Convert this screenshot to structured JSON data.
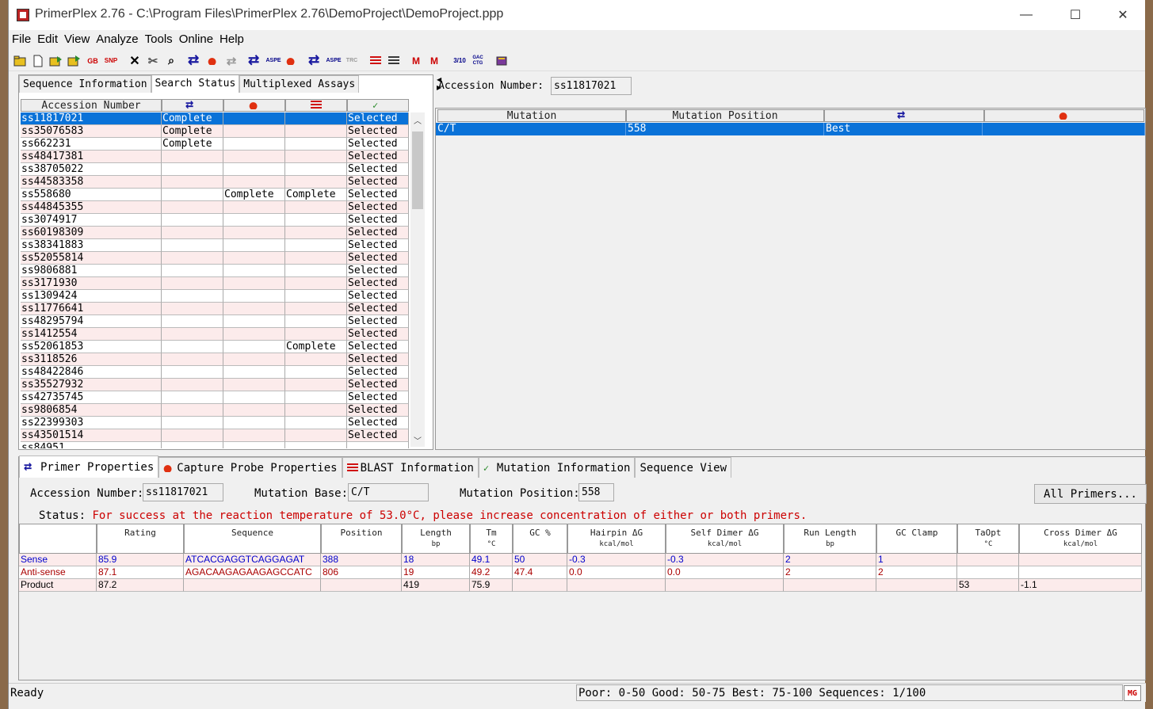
{
  "window": {
    "title": "PrimerPlex 2.76 - C:\\Program Files\\PrimerPlex 2.76\\DemoProject\\DemoProject.ppp",
    "minimize": "—",
    "maximize": "☐",
    "close": "✕"
  },
  "menu": [
    "File",
    "Edit",
    "View",
    "Analyze",
    "Tools",
    "Online",
    "Help"
  ],
  "toolbar": {
    "icons": [
      "open-folder-icon",
      "new-file-icon",
      "open-project-icon",
      "save-project-icon",
      "genbank-icon",
      "snp-icon",
      "delete-icon",
      "tools-icon",
      "find-icon",
      "primer-search-icon",
      "probe-search-icon",
      "primer-disabled-icon",
      "primer-icon",
      "aspe-icon",
      "probe-icon",
      "multiplex-icon",
      "aspe-multiplex-icon",
      "trc-icon",
      "blast-icon",
      "blast-table-icon",
      "mutation-icon",
      "mutation-remove-icon",
      "ratio-icon",
      "sequence-icon",
      "book-icon"
    ],
    "genbank_label": "GB",
    "snp_label": "SNP",
    "aspe_label": "ASPE",
    "aspe2_label": "ASPE",
    "trc_label": "TRC",
    "ratio_label": "3/10",
    "seq_label": "GAC CTG"
  },
  "left_tabs": [
    "Sequence Information",
    "Search Status",
    "Multiplexed Assays"
  ],
  "left_active_tab": "Search Status",
  "search_table": {
    "headers": [
      "Accession Number",
      "primer-icon",
      "probe-icon",
      "blast-icon",
      "mutation-icon"
    ],
    "rows": [
      {
        "acc": "ss11817021",
        "primer": "Complete",
        "probe": "",
        "blast": "",
        "mutation": "Selected"
      },
      {
        "acc": "ss35076583",
        "primer": "Complete",
        "probe": "",
        "blast": "",
        "mutation": "Selected"
      },
      {
        "acc": "ss662231",
        "primer": "Complete",
        "probe": "",
        "blast": "",
        "mutation": "Selected"
      },
      {
        "acc": "ss48417381",
        "primer": "",
        "probe": "",
        "blast": "",
        "mutation": "Selected"
      },
      {
        "acc": "ss38705022",
        "primer": "",
        "probe": "",
        "blast": "",
        "mutation": "Selected"
      },
      {
        "acc": "ss44583358",
        "primer": "",
        "probe": "",
        "blast": "",
        "mutation": "Selected"
      },
      {
        "acc": "ss558680",
        "primer": "",
        "probe": "Complete",
        "blast": "Complete",
        "mutation": "Selected"
      },
      {
        "acc": "ss44845355",
        "primer": "",
        "probe": "",
        "blast": "",
        "mutation": "Selected"
      },
      {
        "acc": "ss3074917",
        "primer": "",
        "probe": "",
        "blast": "",
        "mutation": "Selected"
      },
      {
        "acc": "ss60198309",
        "primer": "",
        "probe": "",
        "blast": "",
        "mutation": "Selected"
      },
      {
        "acc": "ss38341883",
        "primer": "",
        "probe": "",
        "blast": "",
        "mutation": "Selected"
      },
      {
        "acc": "ss52055814",
        "primer": "",
        "probe": "",
        "blast": "",
        "mutation": "Selected"
      },
      {
        "acc": "ss9806881",
        "primer": "",
        "probe": "",
        "blast": "",
        "mutation": "Selected"
      },
      {
        "acc": "ss3171930",
        "primer": "",
        "probe": "",
        "blast": "",
        "mutation": "Selected"
      },
      {
        "acc": "ss1309424",
        "primer": "",
        "probe": "",
        "blast": "",
        "mutation": "Selected"
      },
      {
        "acc": "ss11776641",
        "primer": "",
        "probe": "",
        "blast": "",
        "mutation": "Selected"
      },
      {
        "acc": "ss48295794",
        "primer": "",
        "probe": "",
        "blast": "",
        "mutation": "Selected"
      },
      {
        "acc": "ss1412554",
        "primer": "",
        "probe": "",
        "blast": "",
        "mutation": "Selected"
      },
      {
        "acc": "ss52061853",
        "primer": "",
        "probe": "",
        "blast": "Complete",
        "mutation": "Selected"
      },
      {
        "acc": "ss3118526",
        "primer": "",
        "probe": "",
        "blast": "",
        "mutation": "Selected"
      },
      {
        "acc": "ss48422846",
        "primer": "",
        "probe": "",
        "blast": "",
        "mutation": "Selected"
      },
      {
        "acc": "ss35527932",
        "primer": "",
        "probe": "",
        "blast": "",
        "mutation": "Selected"
      },
      {
        "acc": "ss42735745",
        "primer": "",
        "probe": "",
        "blast": "",
        "mutation": "Selected"
      },
      {
        "acc": "ss9806854",
        "primer": "",
        "probe": "",
        "blast": "",
        "mutation": "Selected"
      },
      {
        "acc": "ss22399303",
        "primer": "",
        "probe": "",
        "blast": "",
        "mutation": "Selected"
      },
      {
        "acc": "ss43501514",
        "primer": "",
        "probe": "",
        "blast": "",
        "mutation": "Selected"
      },
      {
        "acc": "ss84951",
        "primer": "",
        "probe": "",
        "blast": "",
        "mutation": ""
      }
    ],
    "selected_index": 0
  },
  "right_panel": {
    "accession_label": "Accession Number:",
    "accession_value": "ss11817021",
    "mutation_headers": [
      "Mutation",
      "Mutation Position",
      "primer-icon",
      "probe-icon"
    ],
    "mutation_row": [
      "C/T",
      "558",
      "Best",
      ""
    ]
  },
  "bottom_tabs": [
    "Primer Properties",
    "Capture Probe Properties",
    "BLAST Information",
    "Mutation Information",
    "Sequence View"
  ],
  "bottom_active_tab": "Primer Properties",
  "primer_props": {
    "accession_label": "Accession Number:",
    "accession_value": "ss11817021",
    "mutation_base_label": "Mutation Base:",
    "mutation_base_value": "C/T",
    "mutation_position_label": "Mutation Position:",
    "mutation_position_value": "558",
    "all_primers_button": "All Primers...",
    "status_label": "Status:",
    "status_message": "For success at the reaction temperature of 53.0°C, please increase concentration of either or both primers."
  },
  "primer_table": {
    "headers": [
      {
        "name": "",
        "unit": ""
      },
      {
        "name": "Rating",
        "unit": ""
      },
      {
        "name": "Sequence",
        "unit": ""
      },
      {
        "name": "Position",
        "unit": ""
      },
      {
        "name": "Length",
        "unit": "bp"
      },
      {
        "name": "Tm",
        "unit": "°C"
      },
      {
        "name": "GC %",
        "unit": ""
      },
      {
        "name": "Hairpin ΔG",
        "unit": "kcal/mol"
      },
      {
        "name": "Self Dimer ΔG",
        "unit": "kcal/mol"
      },
      {
        "name": "Run Length",
        "unit": "bp"
      },
      {
        "name": "GC Clamp",
        "unit": ""
      },
      {
        "name": "TaOpt",
        "unit": "°C"
      },
      {
        "name": "Cross Dimer ΔG",
        "unit": "kcal/mol"
      }
    ],
    "rows": [
      [
        "Sense",
        "85.9",
        "ATCACGAGGTCAGGAGAT",
        "388",
        "18",
        "49.1",
        "50",
        "-0.3",
        "-0.3",
        "2",
        "1",
        "",
        ""
      ],
      [
        "Anti-sense",
        "87.1",
        "AGACAAGAGAAGAGCCATC",
        "806",
        "19",
        "49.2",
        "47.4",
        "0.0",
        "0.0",
        "2",
        "2",
        "",
        ""
      ],
      [
        "Product",
        "87.2",
        "",
        "",
        "419",
        "75.9",
        "",
        "",
        "",
        "",
        "",
        "53",
        "-1.1"
      ]
    ]
  },
  "statusbar": {
    "ready": "Ready",
    "legend": "Poor: 0-50 Good: 50-75 Best: 75-100     Sequences: 1/100",
    "logo": "MG"
  }
}
